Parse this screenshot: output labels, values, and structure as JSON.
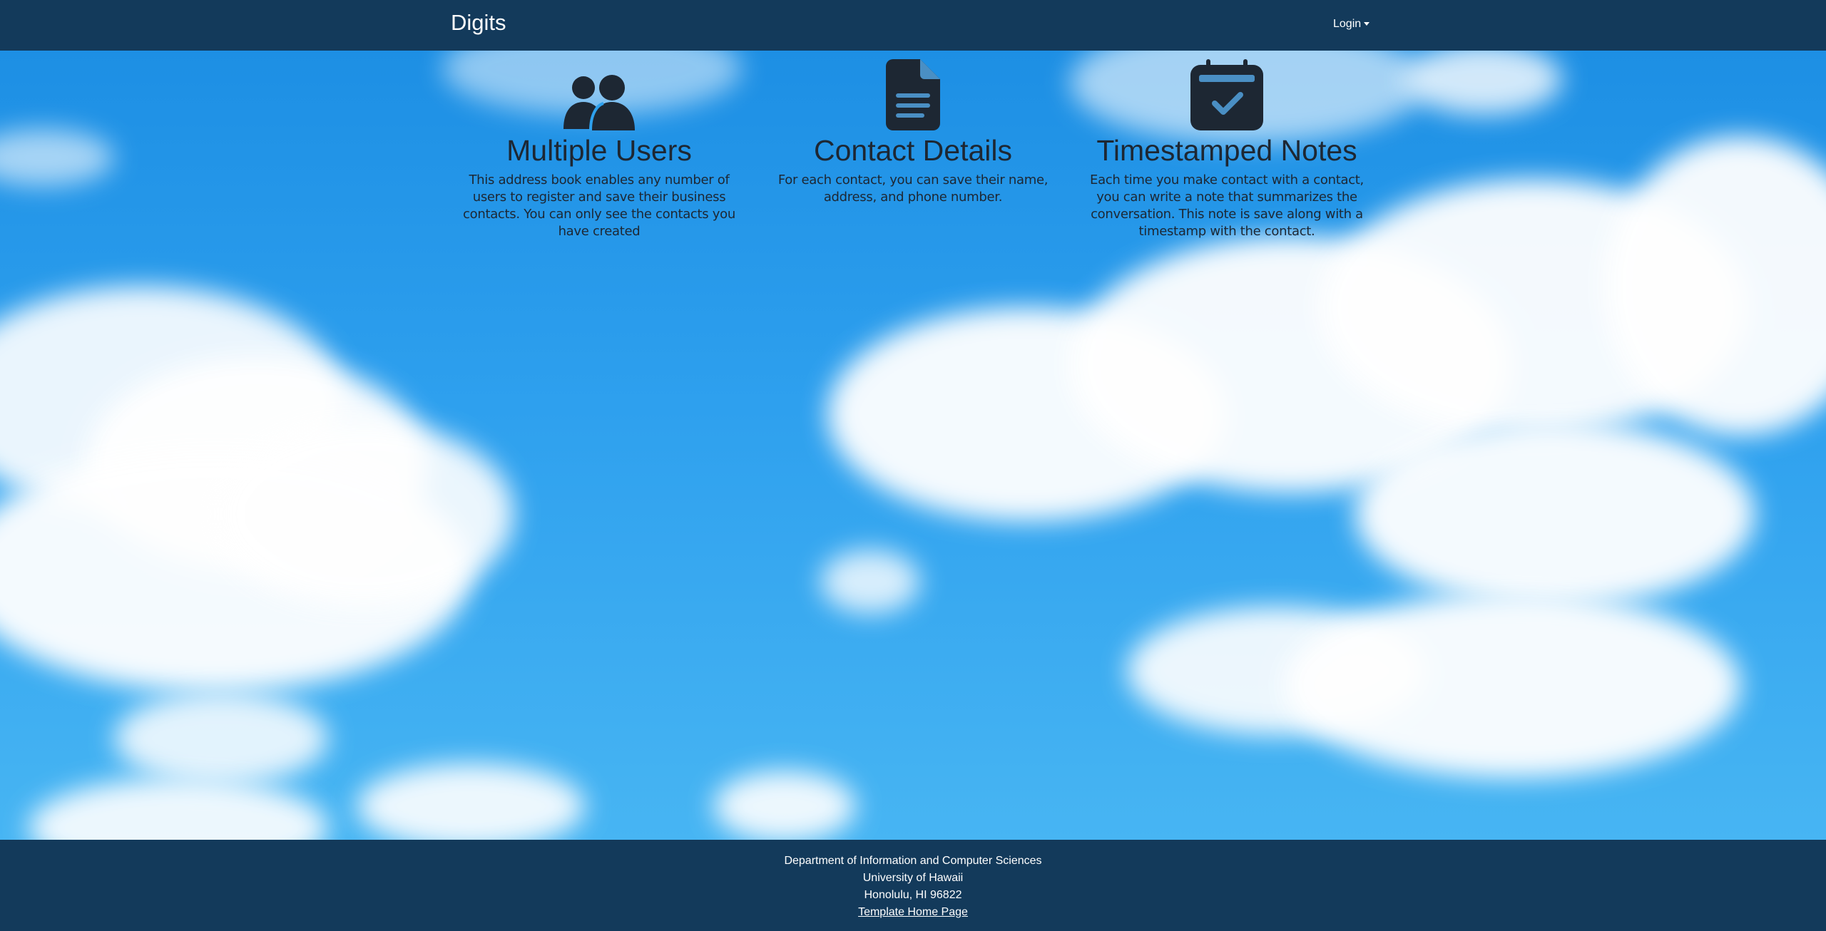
{
  "navbar": {
    "brand": "Digits",
    "login_label": "Login"
  },
  "features": [
    {
      "icon": "users-icon",
      "title": "Multiple Users",
      "description": "This address book enables any number of users to register and save their business contacts. You can only see the contacts you have created"
    },
    {
      "icon": "file-lines-icon",
      "title": "Contact Details",
      "description": "For each contact, you can save their name, address, and phone number."
    },
    {
      "icon": "calendar-check-icon",
      "title": "Timestamped Notes",
      "description": "Each time you make contact with a contact, you can write a note that summarizes the conversation. This note is save along with a timestamp with the contact."
    }
  ],
  "footer": {
    "line1": "Department of Information and Computer Sciences",
    "line2": "University of Hawaii",
    "line3": "Honolulu, HI 96822",
    "link": "Template Home Page"
  },
  "colors": {
    "navbar_bg": "#133a5b",
    "sky": "#2ea1ee",
    "text_dark": "#1d2733"
  }
}
